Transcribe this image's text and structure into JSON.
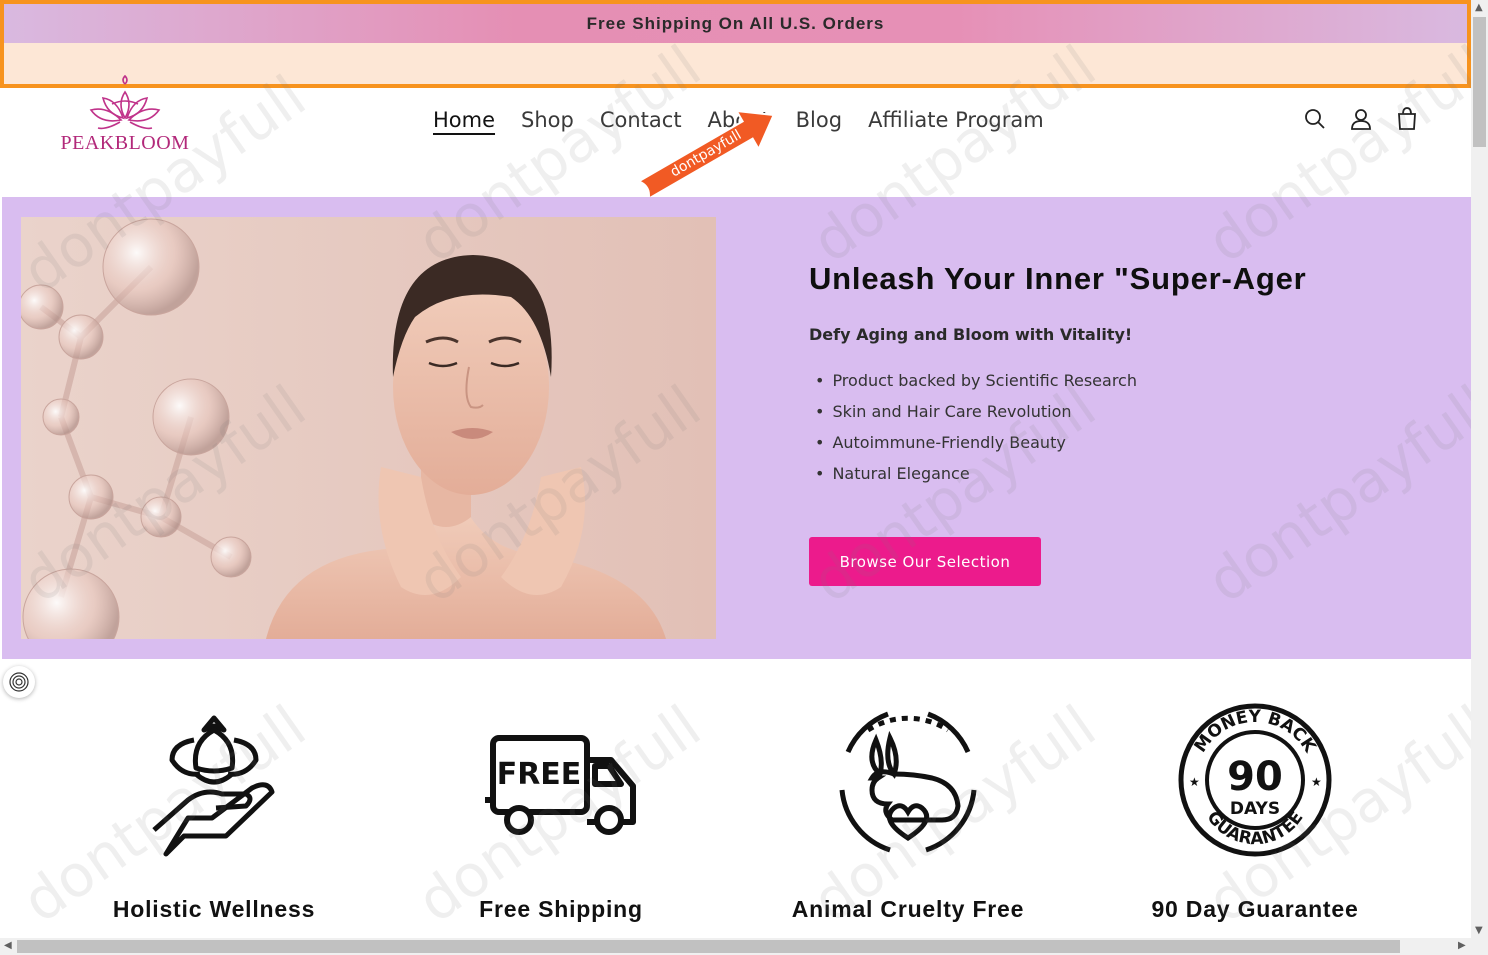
{
  "announcement": {
    "text": "Free Shipping On All U.S. Orders"
  },
  "brand": {
    "name": "PEAKBLOOM",
    "color": "#b2287a"
  },
  "nav": {
    "items": [
      {
        "label": "Home",
        "active": true
      },
      {
        "label": "Shop"
      },
      {
        "label": "Contact"
      },
      {
        "label": "About"
      },
      {
        "label": "Blog"
      },
      {
        "label": "Affiliate Program"
      }
    ]
  },
  "header_icons": [
    "search-icon",
    "account-icon",
    "cart-icon"
  ],
  "ribbon": {
    "text": "dontpayfull"
  },
  "hero": {
    "title": "Unleash Your Inner \"Super-Ager",
    "subtitle": "Defy Aging and Bloom with Vitality!",
    "bullets": [
      "Product backed by Scientific Research",
      "Skin and Hair Care Revolution",
      "Autoimmune-Friendly Beauty",
      "Natural Elegance"
    ],
    "button_label": "Browse Our Selection",
    "background": "#d9bdf0",
    "button_color": "#ec1b8c"
  },
  "features": [
    {
      "label": "Holistic Wellness",
      "icon": "lotus-hand-icon"
    },
    {
      "label": "Free Shipping",
      "icon": "free-truck-icon",
      "icon_text": "FREE"
    },
    {
      "label": "Animal Cruelty Free",
      "icon": "rabbit-heart-icon"
    },
    {
      "label": "90 Day Guarantee",
      "icon": "money-back-badge-icon",
      "badge_top": "MONEY BACK",
      "badge_number": "90",
      "badge_unit": "DAYS",
      "badge_bottom": "GUARANTEE"
    }
  ],
  "watermark": "dontpayfull"
}
